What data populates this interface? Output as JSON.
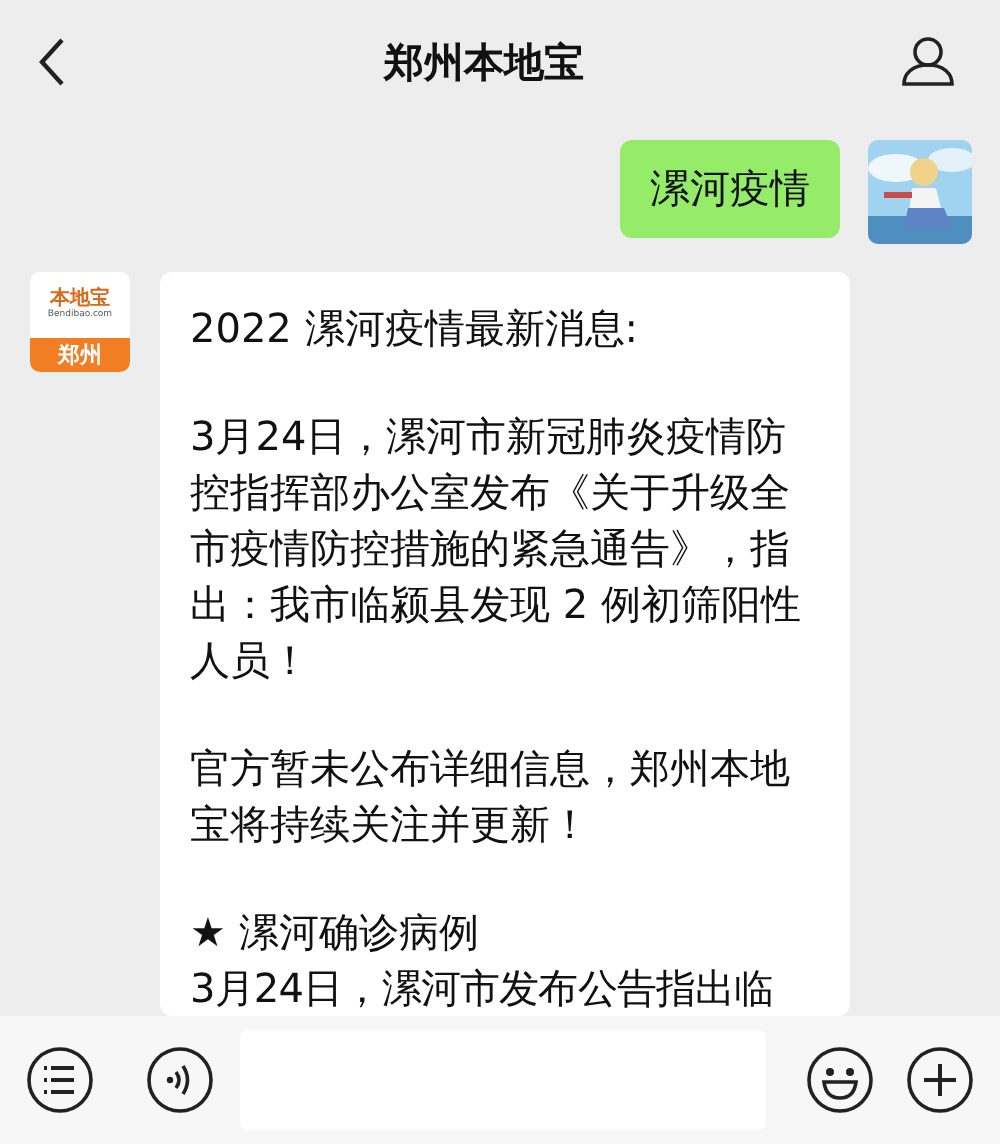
{
  "header": {
    "title": "郑州本地宝"
  },
  "messages": [
    {
      "kind": "sent",
      "text": "漯河疫情"
    },
    {
      "kind": "received",
      "avatar": {
        "kind": "logo",
        "brand": "本地宝",
        "site": "Bendibao.com",
        "city": "郑州"
      },
      "paragraphs": [
        {
          "kind": "para",
          "text": "2022 漯河疫情最新消息:"
        },
        {
          "kind": "para",
          "text": "3月24日，漯河市新冠肺炎疫情防控指挥部办公室发布《关于升级全市疫情防控措施的紧急通告》，指出：我市临颍县发现 2 例初筛阳性人员！"
        },
        {
          "kind": "para",
          "text": "官方暂未公布详细信息，郑州本地宝将持续关注并更新！"
        },
        {
          "kind": "heading",
          "text": "★ 漯河确诊病例"
        },
        {
          "kind": "line",
          "text": "3月24日，漯河市发布公告指出临"
        }
      ]
    }
  ]
}
